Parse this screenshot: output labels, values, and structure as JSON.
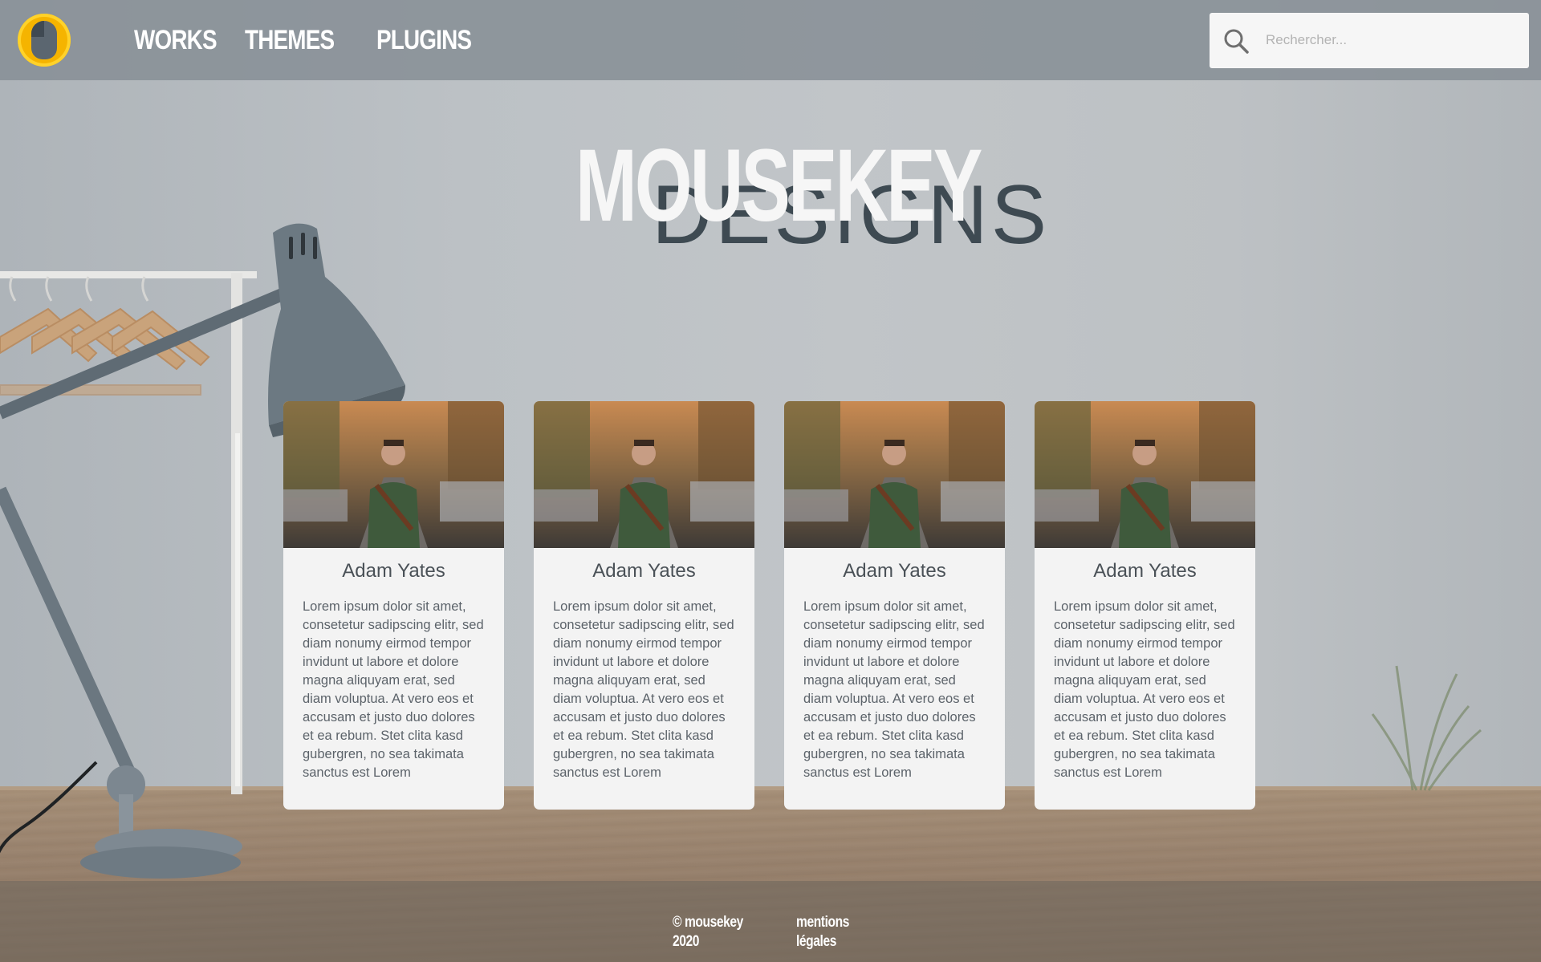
{
  "header": {
    "logo_icon": "mouse-logo-icon",
    "nav": [
      {
        "label": "WORKS"
      },
      {
        "label": "THEMES"
      },
      {
        "label": "PLUGINS"
      }
    ],
    "search": {
      "icon": "search-icon",
      "placeholder": "Rechercher...",
      "value": ""
    }
  },
  "hero": {
    "title": "MOUSEKEY",
    "subtitle": "DESIGNS"
  },
  "cards": [
    {
      "name": "Adam Yates",
      "text": "Lorem ipsum dolor sit amet, consetetur sadipscing elitr, sed diam nonumy eirmod tempor invidunt ut labore et dolore magna aliquyam erat, sed diam voluptua. At vero eos et accusam et justo duo dolores et ea rebum. Stet clita kasd gubergren, no sea takimata sanctus est Lorem"
    },
    {
      "name": "Adam Yates",
      "text": "Lorem ipsum dolor sit amet, consetetur sadipscing elitr, sed diam nonumy eirmod tempor invidunt ut labore et dolore magna aliquyam erat, sed diam voluptua. At vero eos et accusam et justo duo dolores et ea rebum. Stet clita kasd gubergren, no sea takimata sanctus est Lorem"
    },
    {
      "name": "Adam Yates",
      "text": "Lorem ipsum dolor sit amet, consetetur sadipscing elitr, sed diam nonumy eirmod tempor invidunt ut labore et dolore magna aliquyam erat, sed diam voluptua. At vero eos et accusam et justo duo dolores et ea rebum. Stet clita kasd gubergren, no sea takimata sanctus est Lorem"
    },
    {
      "name": "Adam Yates",
      "text": "Lorem ipsum dolor sit amet, consetetur sadipscing elitr, sed diam nonumy eirmod tempor invidunt ut labore et dolore magna aliquyam erat, sed diam voluptua. At vero eos et accusam et justo duo dolores et ea rebum. Stet clita kasd gubergren, no sea takimata sanctus est Lorem"
    }
  ],
  "footer": {
    "copyright": "© mousekey 2020",
    "legal_link": "mentions légales"
  },
  "colors": {
    "header_bg": "#878f96",
    "logo_accent": "#f5b400",
    "card_bg": "#f3f3f3",
    "title_front": "#f6f6f6",
    "title_back": "#3e4a52"
  }
}
